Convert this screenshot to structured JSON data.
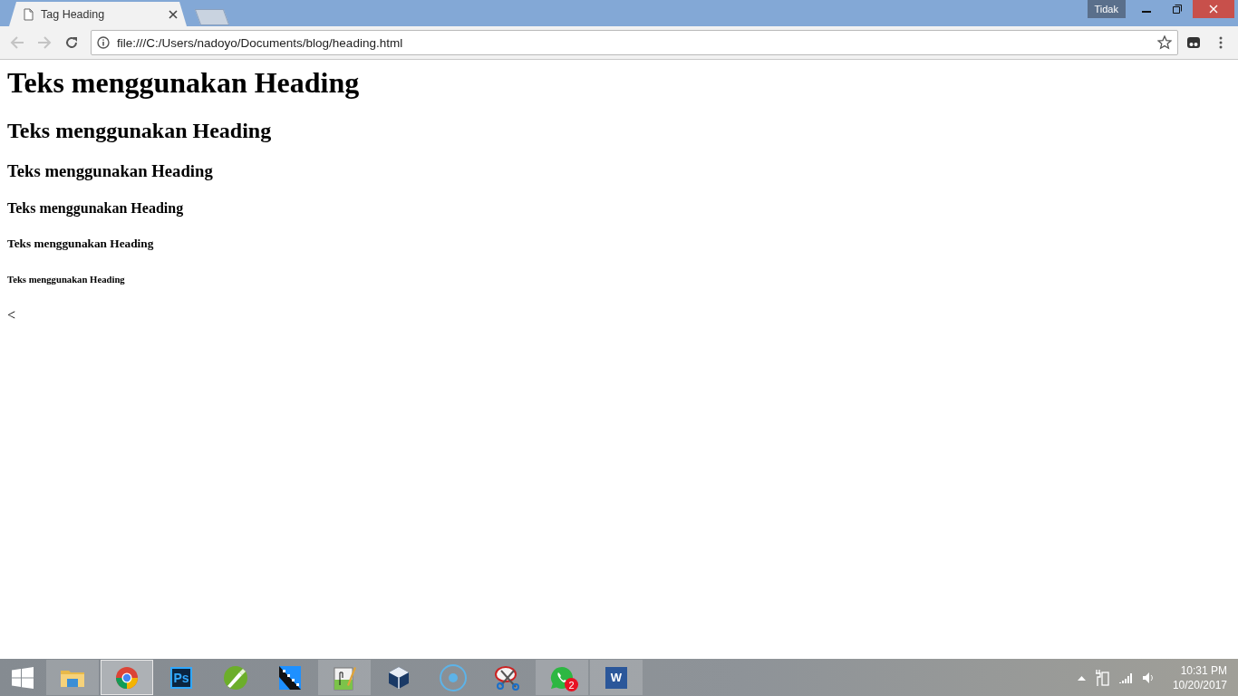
{
  "browser": {
    "tabs": [
      {
        "title": "Tag Heading",
        "selected": true
      }
    ],
    "profile_label": "Tidak",
    "back_disabled": true,
    "forward_disabled": true,
    "address": "file:///C:/Users/nadoyo/Documents/blog/heading.html"
  },
  "page": {
    "blocks": [
      {
        "kind": "h1",
        "text": "Teks menggunakan Heading"
      },
      {
        "kind": "h2",
        "text": "Teks menggunakan Heading"
      },
      {
        "kind": "h3",
        "text": "Teks menggunakan Heading"
      },
      {
        "kind": "h4",
        "text": "Teks menggunakan Heading"
      },
      {
        "kind": "h5",
        "text": "Teks menggunakan Heading"
      },
      {
        "kind": "h6",
        "text": "Teks menggunakan Heading"
      },
      {
        "kind": "p",
        "text": "<"
      }
    ]
  },
  "taskbar": {
    "apps": [
      {
        "kind": "folder",
        "open": true,
        "selected": false
      },
      {
        "kind": "browser",
        "open": true,
        "selected": true
      },
      {
        "kind": "ps",
        "glyph": "Ps",
        "open": false,
        "selected": false
      },
      {
        "kind": "pen",
        "open": false,
        "selected": false
      },
      {
        "kind": "clapper",
        "open": false,
        "selected": false
      },
      {
        "kind": "notepad",
        "open": true,
        "selected": false
      },
      {
        "kind": "cube",
        "open": false,
        "selected": false
      },
      {
        "kind": "ring",
        "open": false,
        "selected": false
      },
      {
        "kind": "scissors",
        "open": false,
        "selected": false
      },
      {
        "kind": "chat",
        "badge": "2",
        "open": true,
        "selected": false
      },
      {
        "kind": "word",
        "glyph": "W",
        "open": true,
        "selected": false
      }
    ],
    "clock": {
      "time": "10:31 PM",
      "date": "10/20/2017"
    }
  }
}
